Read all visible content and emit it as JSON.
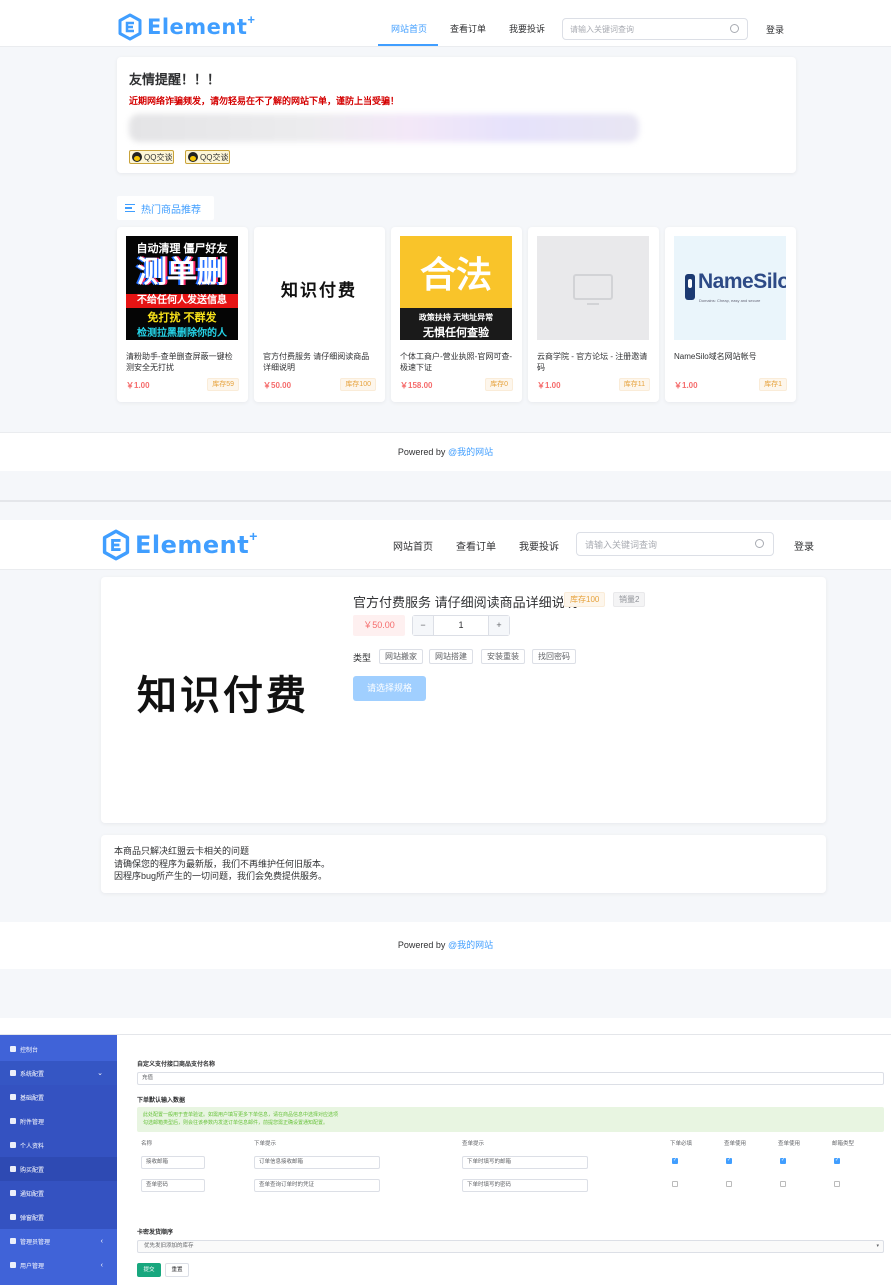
{
  "colors": {
    "primary": "#409eff",
    "warning": "#e6a23c",
    "danger": "#f56c6c",
    "sidebar": "#4063d8",
    "success": "#18a77e"
  },
  "header": {
    "logo": "Element",
    "logo_sup": "+",
    "nav": [
      "网站首页",
      "查看订单",
      "我要投诉"
    ],
    "search_placeholder": "请输入关键词查询",
    "login": "登录"
  },
  "notice": {
    "title": "友情提醒！！！",
    "warning": "近期网络诈骗频发，请勿轻易在不了解的网站下单，谨防上当受骗！",
    "qq_buttons": [
      "QQ交谈",
      "QQ交谈"
    ]
  },
  "hot": {
    "label": "热门商品推荐"
  },
  "products": [
    {
      "name": "清粉助手-查单删查屏蔽一键检测安全无打扰",
      "price": "￥1.00",
      "stock": "库存59",
      "img": {
        "line1": "自动清理 僵尸好友",
        "line2": "测单删",
        "line3": "不给任何人发送信息",
        "line4": "免打扰 不群发",
        "line5": "检测拉黑删除你的人"
      }
    },
    {
      "name": "官方付费服务 请仔细阅读商品详细说明",
      "price": "￥50.00",
      "stock": "库存100",
      "img": {
        "text": "知识付费"
      }
    },
    {
      "name": "个体工商户-营业执照-官网可查-极速下证",
      "price": "￥158.00",
      "stock": "库存0",
      "img": {
        "big": "合法",
        "line1": "政策扶持 无地址异常",
        "line2": "无惧任何查验"
      }
    },
    {
      "name": "云商学院 - 官方论坛 - 注册邀请码",
      "price": "￥1.00",
      "stock": "库存11",
      "img": {}
    },
    {
      "name": "NameSilo域名网站帐号",
      "price": "￥1.00",
      "stock": "库存1",
      "img": {
        "brand": "NameSilo",
        "tag": "Domains: Cheap, easy and secure"
      }
    }
  ],
  "footer": {
    "powered": "Powered by ",
    "link": "@我的网站"
  },
  "detail": {
    "title": "官方付费服务 请仔细阅读商品详细说明",
    "stock": "库存100",
    "sold": "销量2",
    "price": "￥50.00",
    "qty": "1",
    "minus": "−",
    "plus": "+",
    "type_label": "类型",
    "types": [
      "网站搬家",
      "网站搭建",
      "安装重装",
      "找回密码"
    ],
    "select_button": "请选择规格",
    "image_text": "知识付费",
    "desc": [
      "本商品只解决红盟云卡相关的问题",
      "请确保您的程序为最新版，我们不再维护任何旧版本。",
      "因程序bug所产生的一切问题，我们会免费提供服务。"
    ]
  },
  "admin": {
    "menu": [
      {
        "label": "控制台",
        "chev": ""
      },
      {
        "label": "系统配置",
        "chev": "⌄"
      },
      {
        "label": "基础配置",
        "chev": ""
      },
      {
        "label": "附件管理",
        "chev": ""
      },
      {
        "label": "个人资料",
        "chev": ""
      },
      {
        "label": "购买配置",
        "chev": ""
      },
      {
        "label": "通知配置",
        "chev": ""
      },
      {
        "label": "弹窗配置",
        "chev": ""
      },
      {
        "label": "管理员管理",
        "chev": "‹"
      },
      {
        "label": "用户管理",
        "chev": "‹"
      }
    ],
    "custom_pay_label": "自定义支付接口商品支付名称",
    "custom_pay_value": "充值",
    "input_label": "下单默认输入数据",
    "alert_line1": "此处配置一般用于查单验证。如需用户填写更多下单信息，请在商品信息中选择对应选项",
    "alert_line2": "勾选邮箱类型后，则会往该参数内发送订单信息邮件，前提您需正确设置通知配置。",
    "headers": [
      "名称",
      "下单提示",
      "查单提示",
      "下单必填",
      "查单使用",
      "查单使用",
      "邮箱类型"
    ],
    "rows": [
      {
        "name": "接收邮箱",
        "order_hint": "订单信息接收邮箱",
        "query_hint": "下单时填写的邮箱"
      },
      {
        "name": "查单密码",
        "order_hint": "查单查询订单时的凭证",
        "query_hint": "下单时填写的密码"
      }
    ],
    "checked_row1": [
      true,
      true,
      true,
      true
    ],
    "checked_row2": [
      false,
      false,
      false,
      false
    ],
    "card_order_label": "卡密发货顺序",
    "card_order_value": "优先发旧添加的库存",
    "submit": "提交",
    "reset": "重置"
  }
}
